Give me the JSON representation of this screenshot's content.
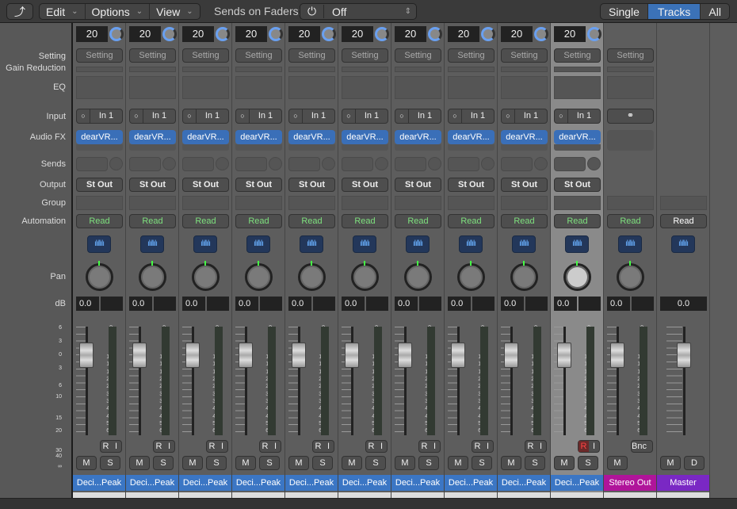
{
  "toolbar": {
    "back_icon": "back-arrow-icon",
    "edit": "Edit",
    "options": "Options",
    "view": "View",
    "sends_label": "Sends on Faders:",
    "sends_value": "Off",
    "power_icon": "power-icon",
    "single": "Single",
    "tracks": "Tracks",
    "all": "All",
    "active_view": "Tracks"
  },
  "labels": {
    "setting": "Setting",
    "gain_reduction": "Gain Reduction",
    "eq": "EQ",
    "input": "Input",
    "audio_fx": "Audio FX",
    "sends": "Sends",
    "output": "Output",
    "group": "Group",
    "automation": "Automation",
    "pan": "Pan",
    "db": "dB"
  },
  "fader_scale": [
    "6",
    "3",
    "0",
    "3",
    "6",
    "10",
    "15",
    "20",
    "30",
    "40",
    "∞"
  ],
  "meter_scale": [
    "0",
    "3",
    "6",
    "9",
    "12",
    "15",
    "18",
    "21",
    "24",
    "30",
    "35",
    "40",
    "45",
    "50",
    "60"
  ],
  "channels": [
    {
      "type": "track",
      "number": "20",
      "setting": "Setting",
      "input": "In 1",
      "fx": "dearVR...",
      "output": "St Out",
      "automation": "Read",
      "db": "0.0",
      "name": "Deci...Peak",
      "rec": "R",
      "input_mon": "I",
      "mute": "M",
      "solo": "S",
      "color": "#3b76c4"
    },
    {
      "type": "track",
      "number": "20",
      "setting": "Setting",
      "input": "In 1",
      "fx": "dearVR...",
      "output": "St Out",
      "automation": "Read",
      "db": "0.0",
      "name": "Deci...Peak",
      "rec": "R",
      "input_mon": "I",
      "mute": "M",
      "solo": "S",
      "color": "#3b76c4"
    },
    {
      "type": "track",
      "number": "20",
      "setting": "Setting",
      "input": "In 1",
      "fx": "dearVR...",
      "output": "St Out",
      "automation": "Read",
      "db": "0.0",
      "name": "Deci...Peak",
      "rec": "R",
      "input_mon": "I",
      "mute": "M",
      "solo": "S",
      "color": "#3b76c4"
    },
    {
      "type": "track",
      "number": "20",
      "setting": "Setting",
      "input": "In 1",
      "fx": "dearVR...",
      "output": "St Out",
      "automation": "Read",
      "db": "0.0",
      "name": "Deci...Peak",
      "rec": "R",
      "input_mon": "I",
      "mute": "M",
      "solo": "S",
      "color": "#3b76c4"
    },
    {
      "type": "track",
      "number": "20",
      "setting": "Setting",
      "input": "In 1",
      "fx": "dearVR...",
      "output": "St Out",
      "automation": "Read",
      "db": "0.0",
      "name": "Deci...Peak",
      "rec": "R",
      "input_mon": "I",
      "mute": "M",
      "solo": "S",
      "color": "#3b76c4"
    },
    {
      "type": "track",
      "number": "20",
      "setting": "Setting",
      "input": "In 1",
      "fx": "dearVR...",
      "output": "St Out",
      "automation": "Read",
      "db": "0.0",
      "name": "Deci...Peak",
      "rec": "R",
      "input_mon": "I",
      "mute": "M",
      "solo": "S",
      "color": "#3b76c4"
    },
    {
      "type": "track",
      "number": "20",
      "setting": "Setting",
      "input": "In 1",
      "fx": "dearVR...",
      "output": "St Out",
      "automation": "Read",
      "db": "0.0",
      "name": "Deci...Peak",
      "rec": "R",
      "input_mon": "I",
      "mute": "M",
      "solo": "S",
      "color": "#3b76c4"
    },
    {
      "type": "track",
      "number": "20",
      "setting": "Setting",
      "input": "In 1",
      "fx": "dearVR...",
      "output": "St Out",
      "automation": "Read",
      "db": "0.0",
      "name": "Deci...Peak",
      "rec": "R",
      "input_mon": "I",
      "mute": "M",
      "solo": "S",
      "color": "#3b76c4"
    },
    {
      "type": "track",
      "number": "20",
      "setting": "Setting",
      "input": "In 1",
      "fx": "dearVR...",
      "output": "St Out",
      "automation": "Read",
      "db": "0.0",
      "name": "Deci...Peak",
      "rec": "R",
      "input_mon": "I",
      "mute": "M",
      "solo": "S",
      "color": "#3b76c4"
    },
    {
      "type": "track",
      "selected": true,
      "rec_armed": true,
      "number": "20",
      "setting": "Setting",
      "input": "In 1",
      "fx": "dearVR...",
      "output": "St Out",
      "automation": "Read",
      "db": "0.0",
      "name": "Deci...Peak",
      "rec": "R",
      "input_mon": "I",
      "mute": "M",
      "solo": "S",
      "color": "#3b76c4"
    },
    {
      "type": "output",
      "setting": "Setting",
      "input_icon": "stereo-link-icon",
      "automation": "Read",
      "db": "0.0",
      "name": "Stereo Out",
      "bounce": "Bnc",
      "mute": "M",
      "color": "#b0149a"
    },
    {
      "type": "master",
      "automation": "Read",
      "db": "0.0",
      "name": "Master",
      "mute": "M",
      "dim": "D",
      "color": "#7a28c4"
    }
  ]
}
